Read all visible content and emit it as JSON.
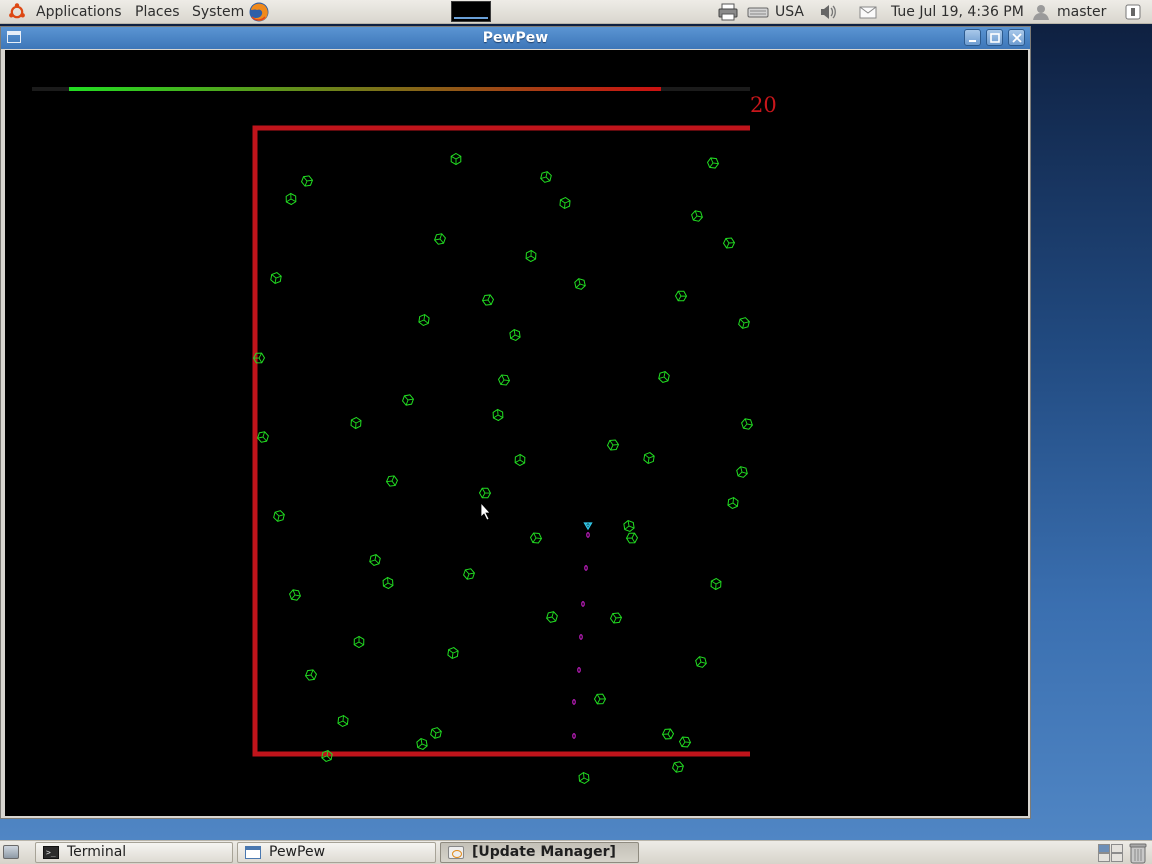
{
  "top_panel": {
    "menus": [
      "Applications",
      "Places",
      "System"
    ],
    "keyboard_layout": "USA",
    "datetime": "Tue Jul 19,  4:36 PM",
    "user": "master",
    "icons": [
      "ubuntu-logo-icon",
      "firefox-icon",
      "system-monitor-icon",
      "printer-icon",
      "keyboard-icon",
      "volume-icon",
      "mail-icon",
      "user-icon",
      "power-icon"
    ]
  },
  "window": {
    "title": "PewPew",
    "buttons": [
      "minimize",
      "maximize",
      "close"
    ]
  },
  "game": {
    "score": "20",
    "health_fraction": 0.87,
    "colors": {
      "health_start": "#22dd22",
      "health_end": "#cc1111",
      "arena_border": "#c0141b",
      "enemy": "#22dd22",
      "player": "#33ccee",
      "bullet": "#dd22dd",
      "score": "#c8161b"
    }
  },
  "taskbar": {
    "tasks": [
      {
        "label": "Terminal",
        "icon": "terminal-icon",
        "active": false
      },
      {
        "label": "PewPew",
        "icon": "window-icon",
        "active": false
      },
      {
        "label": "[Update Manager]",
        "icon": "update-manager-icon",
        "active": true
      }
    ]
  }
}
